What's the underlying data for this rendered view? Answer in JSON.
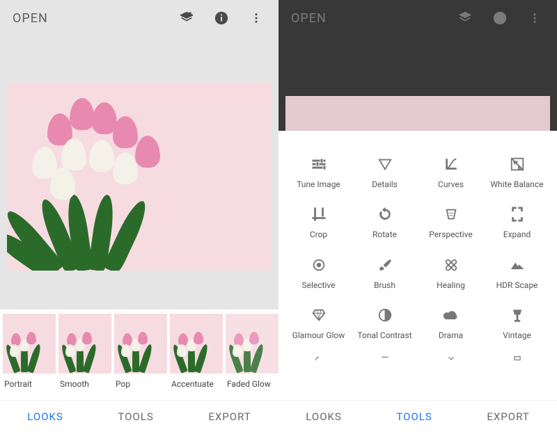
{
  "left": {
    "open": "OPEN",
    "looks": [
      {
        "label": "Portrait"
      },
      {
        "label": "Smooth"
      },
      {
        "label": "Pop"
      },
      {
        "label": "Accentuate"
      },
      {
        "label": "Faded Glow"
      }
    ],
    "nav": {
      "looks": "LOOKS",
      "tools": "TOOLS",
      "export": "EXPORT",
      "active": "LOOKS"
    }
  },
  "right": {
    "open": "OPEN",
    "tools": [
      {
        "label": "Tune Image"
      },
      {
        "label": "Details"
      },
      {
        "label": "Curves"
      },
      {
        "label": "White Balance"
      },
      {
        "label": "Crop"
      },
      {
        "label": "Rotate"
      },
      {
        "label": "Perspective"
      },
      {
        "label": "Expand"
      },
      {
        "label": "Selective"
      },
      {
        "label": "Brush"
      },
      {
        "label": "Healing"
      },
      {
        "label": "HDR Scape"
      },
      {
        "label": "Glamour Glow"
      },
      {
        "label": "Tonal Contrast"
      },
      {
        "label": "Drama"
      },
      {
        "label": "Vintage"
      }
    ],
    "nav": {
      "looks": "LOOKS",
      "tools": "TOOLS",
      "export": "EXPORT",
      "active": "TOOLS"
    }
  }
}
